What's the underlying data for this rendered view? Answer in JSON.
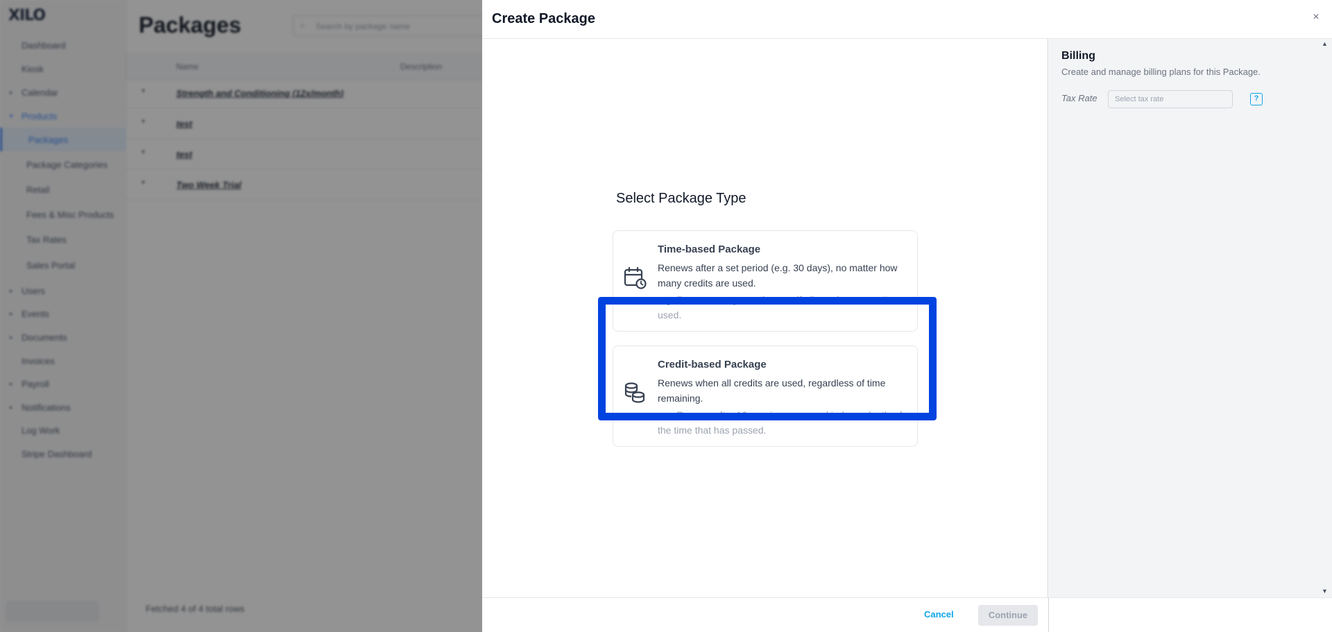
{
  "background": {
    "logo": "XILO",
    "page_title": "Packages",
    "search_placeholder": "Search by package name",
    "nav": [
      {
        "label": "Dashboard",
        "caret": ""
      },
      {
        "label": "Kiosk",
        "caret": ""
      },
      {
        "label": "Calendar",
        "caret": "▸"
      },
      {
        "label": "Products",
        "caret": "▾"
      },
      {
        "label": "Packages",
        "caret": ""
      },
      {
        "label": "Package Categories",
        "caret": ""
      },
      {
        "label": "Retail",
        "caret": ""
      },
      {
        "label": "Fees & Misc Products",
        "caret": ""
      },
      {
        "label": "Tax Rates",
        "caret": ""
      },
      {
        "label": "Sales Portal",
        "caret": ""
      },
      {
        "label": "Users",
        "caret": "▸"
      },
      {
        "label": "Events",
        "caret": "▸"
      },
      {
        "label": "Documents",
        "caret": "▸"
      },
      {
        "label": "Invoices",
        "caret": ""
      },
      {
        "label": "Payroll",
        "caret": "▸"
      },
      {
        "label": "Notifications",
        "caret": "▸"
      },
      {
        "label": "Log Work",
        "caret": ""
      },
      {
        "label": "Stripe Dashboard",
        "caret": ""
      }
    ],
    "table_headers": {
      "name": "Name",
      "description": "Description"
    },
    "rows": [
      {
        "name": "Strength and Conditioning (12x/month)",
        "chev": "▾"
      },
      {
        "name": "test",
        "chev": "▾"
      },
      {
        "name": "test",
        "chev": "▾"
      },
      {
        "name": "Two Week Trial",
        "chev": "▾"
      }
    ],
    "fetched_text": "Fetched 4 of 4 total rows"
  },
  "modal": {
    "title": "Create Package",
    "close_glyph": "×",
    "section_title": "Select Package Type",
    "options": [
      {
        "icon": "calendar-clock-icon",
        "title": "Time-based Package",
        "description": "Renews after a set period (e.g. 30 days), no matter how many credits are used.",
        "example": "e.g. Renews every month, even if all sessions weren't used."
      },
      {
        "icon": "coins-stack-icon",
        "title": "Credit-based Package",
        "description": "Renews when all credits are used, regardless of time remaining.",
        "example": "e.g. Renews after 10 sessions are used independently of the time that has passed."
      }
    ],
    "highlight_color": "#0043e0",
    "billing": {
      "title": "Billing",
      "subtitle": "Create and manage billing plans for this Package.",
      "tax_label": "Tax Rate",
      "tax_placeholder": "Select tax rate",
      "help": "?"
    },
    "scroll_up": "▲",
    "scroll_down": "▼",
    "footer": {
      "cancel": "Cancel",
      "continue": "Continue"
    }
  },
  "colors": {
    "accent": "#0ea5e9",
    "nav_active": "#3b82f6",
    "overlay": "rgba(20,20,20,0.46)"
  }
}
